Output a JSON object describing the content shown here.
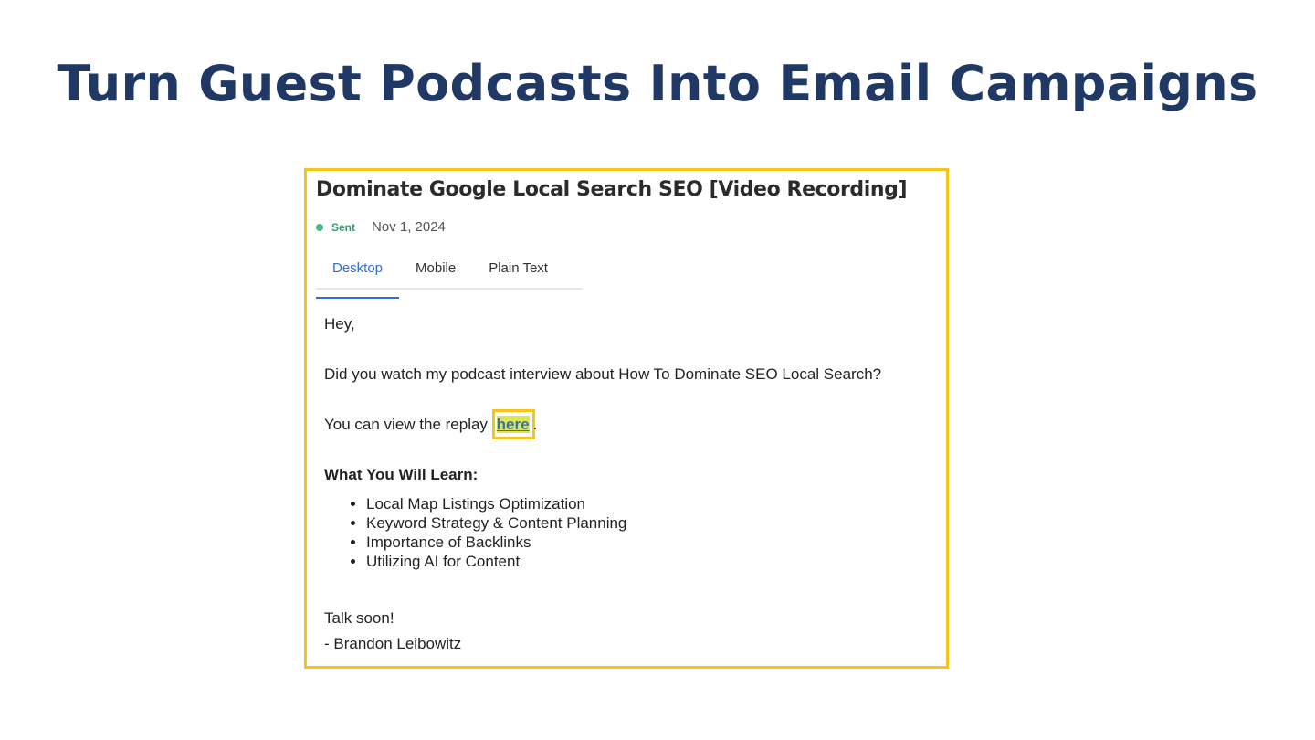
{
  "slide": {
    "title": "Turn Guest Podcasts Into Email Campaigns"
  },
  "email": {
    "subject": "Dominate Google Local Search SEO [Video Recording]",
    "status": "Sent",
    "date": "Nov 1, 2024",
    "tabs": [
      {
        "label": "Desktop",
        "active": true
      },
      {
        "label": "Mobile",
        "active": false
      },
      {
        "label": "Plain Text",
        "active": false
      }
    ],
    "body": {
      "greeting": "Hey,",
      "line1": "Did you watch my podcast interview about How To Dominate SEO Local Search?",
      "line2_prefix": "You can view the replay ",
      "link_text": "here",
      "line2_suffix": ".",
      "learn_heading": "What You Will Learn:",
      "learn_items": [
        "Local Map Listings Optimization",
        "Keyword Strategy & Content Planning",
        "Importance of Backlinks",
        "Utilizing AI for Content"
      ],
      "signoff": "Talk soon!",
      "signature": "- Brandon Leibowitz"
    }
  },
  "colors": {
    "title": "#1f3864",
    "highlight_border": "#f5c518",
    "active_tab": "#2f6fd6",
    "status_green": "#49b985",
    "link_highlight": "#d8e85a"
  },
  "icons": {
    "status": "status-dot-icon"
  }
}
